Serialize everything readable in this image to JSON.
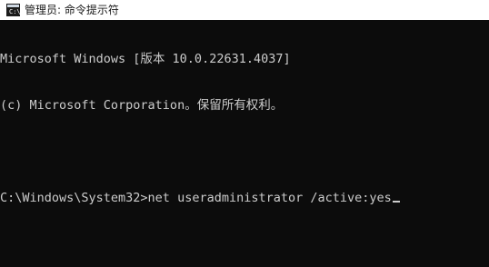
{
  "window": {
    "title": "管理员: 命令提示符",
    "icon": "cmd-icon",
    "icon_glyph": "C:\\"
  },
  "terminal": {
    "lines": [
      "Microsoft Windows [版本 10.0.22631.4037]",
      "(c) Microsoft Corporation。保留所有权利。",
      "",
      "C:\\Windows\\System32>net useradministrator /active:yes"
    ]
  },
  "colors": {
    "background": "#0c0c0c",
    "text": "#cccccc",
    "titlebar": "#ffffff"
  }
}
